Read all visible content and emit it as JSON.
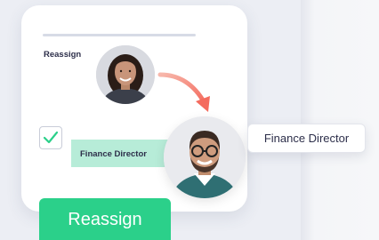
{
  "card": {
    "reassign_label": "Reassign",
    "checkbox_checked": true,
    "highlight_label": "Finance Director"
  },
  "tooltip": {
    "text": "Finance Director"
  },
  "primary_button": {
    "label": "Reassign"
  },
  "colors": {
    "accent_green": "#2bd08a",
    "highlight_green": "#b7ecd8",
    "arrow_red": "#f46b5e",
    "text_dark": "#2d2f4a"
  },
  "icons": [
    "check-icon",
    "arrow-icon"
  ]
}
